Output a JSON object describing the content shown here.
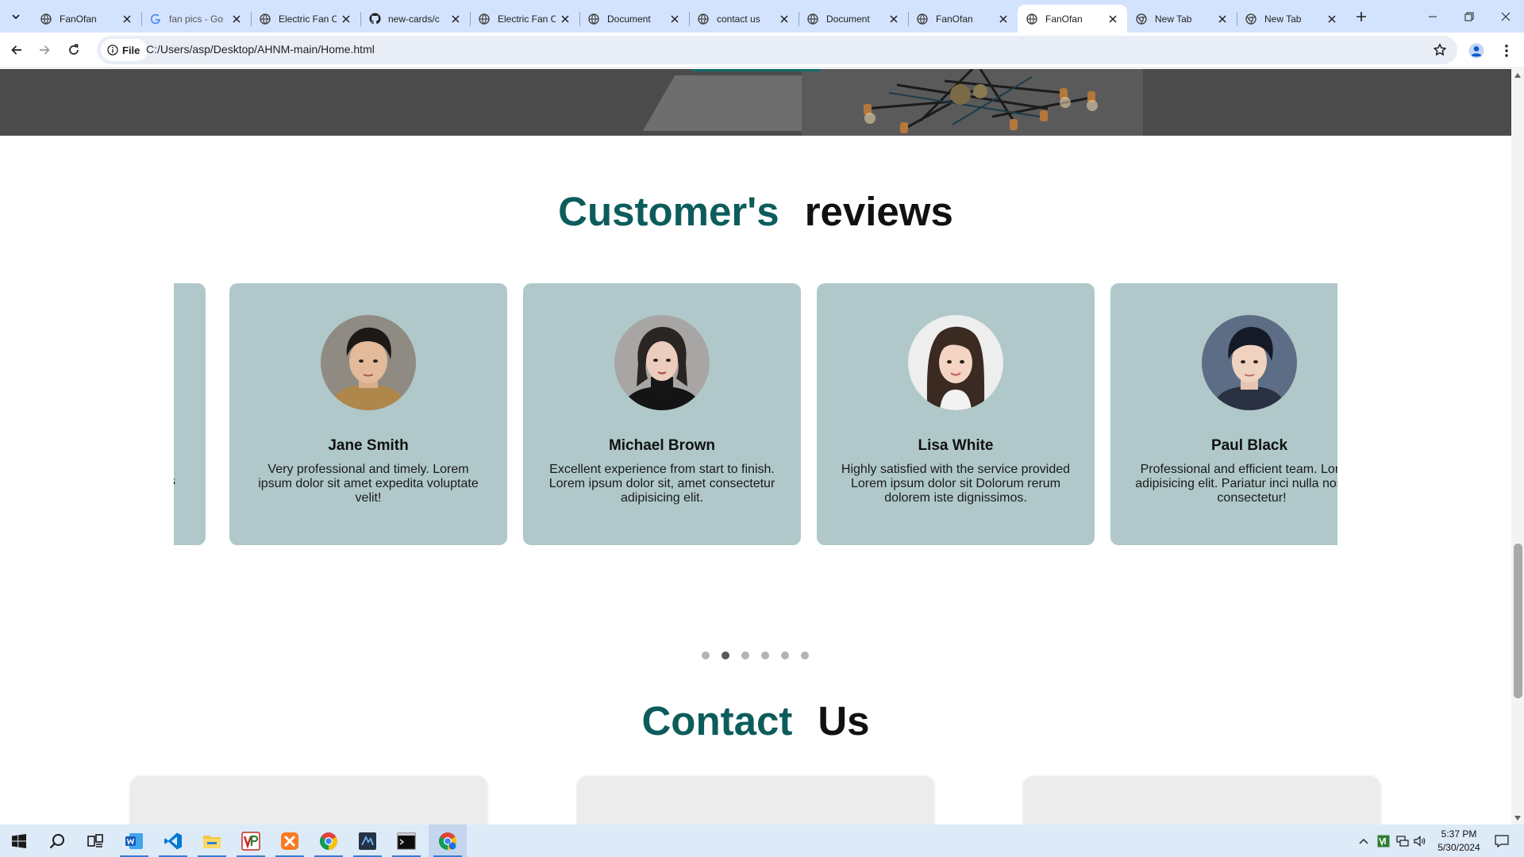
{
  "browser": {
    "tabs": [
      {
        "title": "FanOfan",
        "favicon": "globe-icon",
        "active": false
      },
      {
        "title": "fan pics - Go",
        "favicon": "google-icon",
        "active": false
      },
      {
        "title": "Electric Fan C",
        "favicon": "globe-icon",
        "active": false
      },
      {
        "title": "new-cards/c",
        "favicon": "github-icon",
        "active": false
      },
      {
        "title": "Electric Fan C",
        "favicon": "globe-icon",
        "active": false
      },
      {
        "title": "Document",
        "favicon": "globe-icon",
        "active": false
      },
      {
        "title": "contact us",
        "favicon": "globe-icon",
        "active": false
      },
      {
        "title": "Document",
        "favicon": "globe-icon",
        "active": false
      },
      {
        "title": "FanOfan",
        "favicon": "globe-icon",
        "active": false
      },
      {
        "title": "FanOfan",
        "favicon": "globe-icon",
        "active": true
      },
      {
        "title": "New Tab",
        "favicon": "chrome-icon",
        "active": false
      },
      {
        "title": "New Tab",
        "favicon": "chrome-icon",
        "active": false
      }
    ],
    "site_chip": "File",
    "url": "C:/Users/asp/Desktop/AHNM-main/Home.html"
  },
  "reviews": {
    "title_accent": "Customer's",
    "title_plain": "reviews",
    "partial_card_text": "nis",
    "cards": [
      {
        "name": "Jane Smith",
        "text": "Very professional and timely. Lorem ipsum dolor sit amet expedita voluptate velit!"
      },
      {
        "name": "Michael Brown",
        "text": "Excellent experience from start to finish. Lorem ipsum dolor sit, amet consectetur adipisicing elit."
      },
      {
        "name": "Lisa White",
        "text": "Highly satisfied with the service provided Lorem ipsum dolor sit Dolorum rerum dolorem iste dignissimos."
      },
      {
        "name": "Paul Black",
        "text": "Professional and efficient team. Lorem i adipisicing elit. Pariatur inci nulla nostrum consectetur!"
      }
    ],
    "dots": {
      "count": 6,
      "active_index": 1
    }
  },
  "contact": {
    "title_accent": "Contact",
    "title_plain": "Us"
  },
  "colors": {
    "accent": "#0d5c5c",
    "card_bg": "#b0c8c9",
    "tabstrip": "#d3e3fd"
  },
  "taskbar": {
    "apps": [
      "windows-start-icon",
      "search-icon",
      "task-view-icon",
      "word-icon",
      "vscode-icon",
      "file-explorer-icon",
      "visual-paradigm-icon",
      "xampp-icon",
      "chrome-icon",
      "ide-icon",
      "terminal-icon",
      "chrome-active-icon"
    ],
    "time": "5:37 PM",
    "date": "5/30/2024"
  }
}
